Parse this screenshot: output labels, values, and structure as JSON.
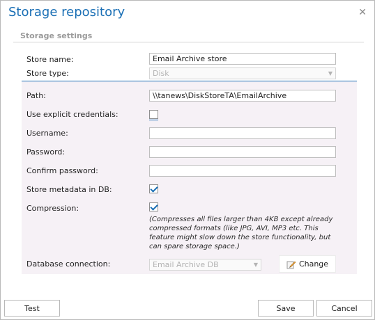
{
  "dialog": {
    "title": "Storage repository",
    "close_icon": "close-icon"
  },
  "section": {
    "title": "Storage settings"
  },
  "fields": {
    "store_name_label": "Store name:",
    "store_name_value": "Email Archive store",
    "store_type_label": "Store type:",
    "store_type_value": "Disk",
    "path_label": "Path:",
    "path_value": "\\\\tanews\\DiskStoreTA\\EmailArchive",
    "explicit_credentials_label": "Use explicit credentials:",
    "explicit_credentials_checked": false,
    "username_label": "Username:",
    "username_value": "",
    "password_label": "Password:",
    "password_value": "",
    "confirm_password_label": "Confirm password:",
    "confirm_password_value": "",
    "metadata_label": "Store metadata in DB:",
    "metadata_checked": true,
    "compression_label": "Compression:",
    "compression_checked": true,
    "compression_note": "(Compresses all files larger than 4KB except already compressed formats (like JPG, AVI, MP3 etc. This feature might slow down the store functionality, but can spare storage space.)",
    "db_connection_label": "Database connection:",
    "db_connection_value": "Email Archive DB",
    "change_label": "Change"
  },
  "footer": {
    "test_label": "Test",
    "save_label": "Save",
    "cancel_label": "Cancel"
  },
  "colors": {
    "accent": "#1a6fb5",
    "panel_bg": "#f6f1f6"
  }
}
